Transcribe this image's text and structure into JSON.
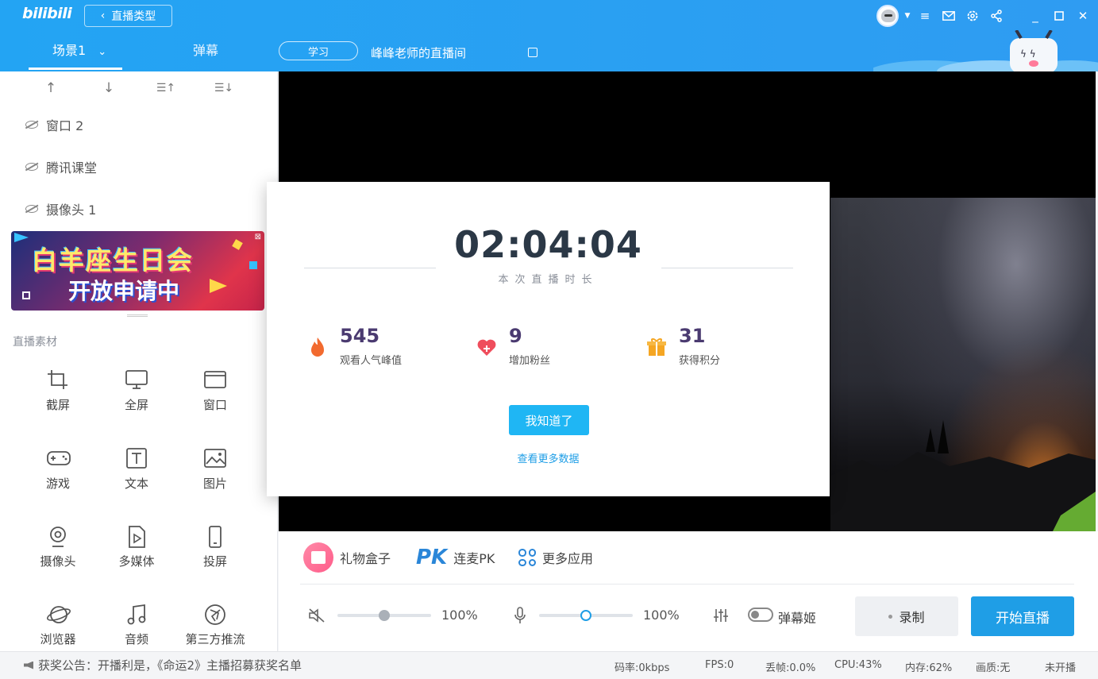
{
  "app": {
    "logo": "bilibili"
  },
  "header": {
    "back_label": "直播类型",
    "tabs": [
      {
        "label": "场景1"
      },
      {
        "label": "弹幕"
      }
    ],
    "category": "学习",
    "room_title": "峰峰老师的直播间",
    "window_controls": [
      "menu-icon",
      "mail-icon",
      "settings-icon",
      "share-icon",
      "minimize-icon",
      "maximize-icon",
      "close-icon"
    ]
  },
  "sources": {
    "items": [
      {
        "label": "窗口 2"
      },
      {
        "label": "腾讯课堂"
      },
      {
        "label": "摄像头 1"
      }
    ]
  },
  "banner": {
    "line1": "白羊座生日会",
    "line2": "开放申请中"
  },
  "assets": {
    "section_label": "直播素材",
    "items": [
      {
        "label": "截屏",
        "icon": "crop-icon"
      },
      {
        "label": "全屏",
        "icon": "monitor-icon"
      },
      {
        "label": "窗口",
        "icon": "window-icon"
      },
      {
        "label": "游戏",
        "icon": "gamepad-icon"
      },
      {
        "label": "文本",
        "icon": "text-icon"
      },
      {
        "label": "图片",
        "icon": "image-icon"
      },
      {
        "label": "摄像头",
        "icon": "camera-icon"
      },
      {
        "label": "多媒体",
        "icon": "media-file-icon"
      },
      {
        "label": "投屏",
        "icon": "phone-cast-icon"
      },
      {
        "label": "浏览器",
        "icon": "browser-icon"
      },
      {
        "label": "音频",
        "icon": "music-icon"
      },
      {
        "label": "第三方推流",
        "icon": "third-party-stream-icon"
      }
    ]
  },
  "dialog": {
    "duration": "02:04:04",
    "duration_label": "本次直播时长",
    "stats": [
      {
        "value": "545",
        "label": "观看人气峰值",
        "icon": "fire-icon",
        "color": "#f26a2f"
      },
      {
        "value": "9",
        "label": "增加粉丝",
        "icon": "heart-plus-icon",
        "color": "#ef4d5c"
      },
      {
        "value": "31",
        "label": "获得积分",
        "icon": "gift-icon",
        "color": "#f5a623"
      }
    ],
    "ok_label": "我知道了",
    "more_label": "查看更多数据"
  },
  "toolbar": {
    "gift_box": "礼物盒子",
    "pk_logo": "PK",
    "pk_label": "连麦PK",
    "more_apps": "更多应用",
    "speaker_volume": "100%",
    "speaker_level": 0.5,
    "mic_volume": "100%",
    "mic_level": 0.5,
    "danmaku_ji": "弹幕姬",
    "record_label": "录制",
    "start_label": "开始直播"
  },
  "status": {
    "announcement": "获奖公告：开播利是，《命运2》主播招募获奖名单",
    "bitrate": "码率:0kbps",
    "fps": "FPS:0",
    "dropped": "丢帧:0.0%",
    "cpu": "CPU:43%",
    "memory": "内存:62%",
    "quality": "画质:无",
    "live_state": "未开播"
  },
  "colors": {
    "header_blue": "#23a4f3",
    "accent_blue": "#1f9ee6",
    "dialog_button": "#1fb6f4"
  }
}
